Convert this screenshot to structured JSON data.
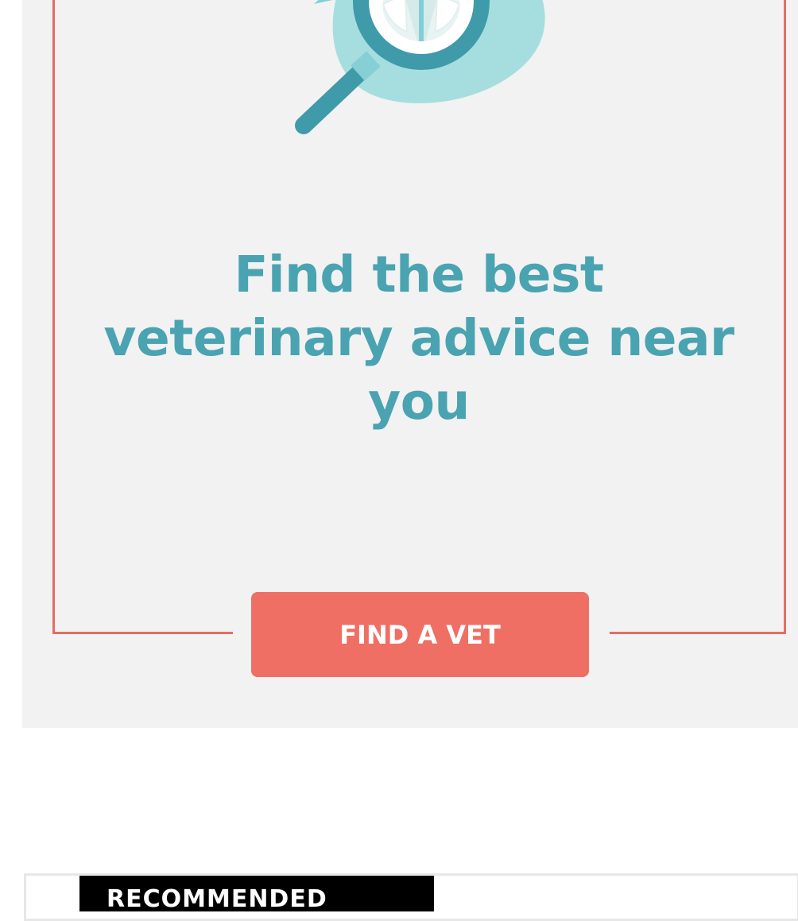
{
  "promo": {
    "headline": "Find the best veterinary advice near you",
    "button_label": "FIND A VET",
    "illustration_icon": "magnifier-vet-icon"
  },
  "recommended": {
    "label": "RECOMMENDED"
  },
  "colors": {
    "accent": "#4aa3b1",
    "button": "#ef6f64",
    "frame": "#e36e62",
    "card_background": "#f2f2f3"
  }
}
